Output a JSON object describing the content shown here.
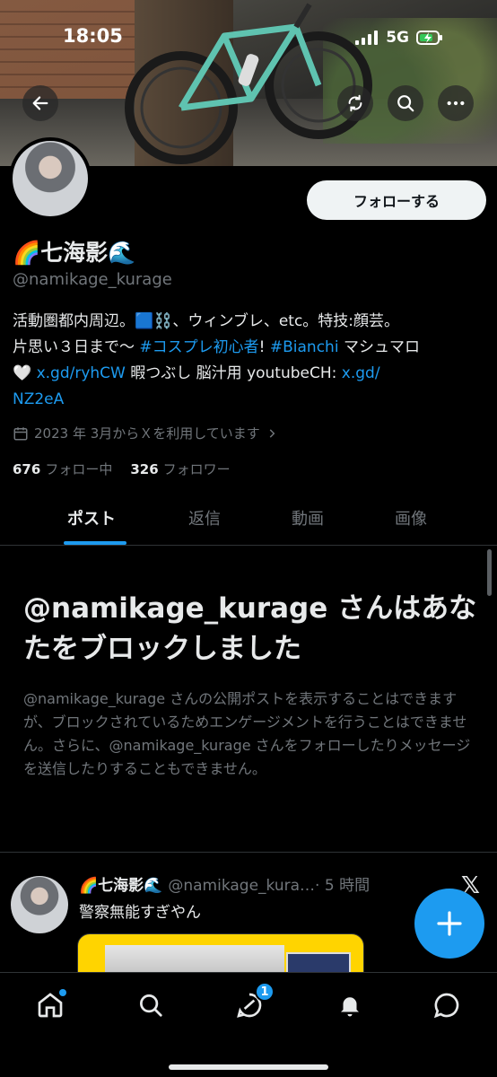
{
  "status": {
    "time": "18:05",
    "network": "5G"
  },
  "profile": {
    "display_name": "🌈七海影🌊",
    "handle": "@namikage_kurage",
    "follow_label": "フォローする",
    "bio": {
      "line1": "活動圏都内周辺。🟦⛓️、ウィンブレ、etc。特技:顔芸。",
      "line2_pre": "片思い３日まで〜 ",
      "hashtag1": "#コスプレ初心者",
      "sep": "! ",
      "hashtag2": "#Bianchi",
      "line2_post": " マシュマロ",
      "marshmallow": "🤍",
      "link1": "x.gd/ryhCW",
      "line3_mid": " 暇つぶし 脳汁用 youtubeCH: ",
      "link2a": "x.gd/",
      "link2b": "NZ2eA"
    },
    "joined": "2023 年 3月からＸを利用しています",
    "following_count": "676",
    "following_label": "フォロー中",
    "followers_count": "326",
    "followers_label": "フォロワー"
  },
  "tabs": [
    {
      "label": "ポスト"
    },
    {
      "label": "返信"
    },
    {
      "label": "動画"
    },
    {
      "label": "画像"
    }
  ],
  "blocked": {
    "title": "@namikage_kurage さんはあなたをブロックしました",
    "body": "@namikage_kurage さんの公開ポストを表示することはできますが、ブロックされているためエンゲージメントを行うことはできません。さらに、@namikage_kurage さんをフォローしたりメッセージを送信したりすることもできません。"
  },
  "post": {
    "name": "🌈七海影🌊",
    "handle": "@namikage_kura…",
    "time": "· 5 時間",
    "text": "警察無能すぎやん"
  },
  "nav": {
    "messages_badge": "1"
  },
  "colors": {
    "accent": "#1d9bf0",
    "background": "#000000",
    "text": "#e7e9ea",
    "muted": "#71767b"
  }
}
